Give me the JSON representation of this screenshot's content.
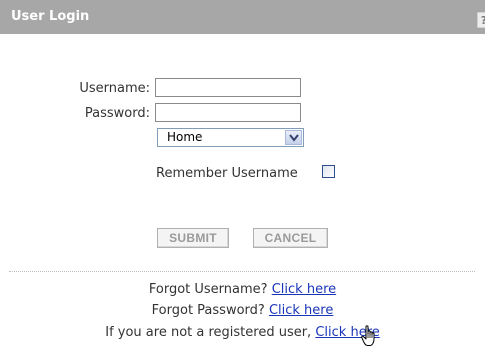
{
  "header": {
    "title": "User Login",
    "help_label": "?"
  },
  "form": {
    "username_label": "Username:",
    "username_value": "",
    "password_label": "Password:",
    "password_value": "",
    "location_select": {
      "selected": "Home"
    },
    "remember_label": "Remember Username",
    "remember_checked": false,
    "submit_label": "SUBMIT",
    "cancel_label": "CANCEL"
  },
  "footer": {
    "forgot_username_text": "Forgot Username?",
    "forgot_username_link": "Click here",
    "forgot_password_text": "Forgot Password?",
    "forgot_password_link": "Click here",
    "register_text": "If you are not a registered user,",
    "register_link": "Click here"
  },
  "colors": {
    "header_bg": "#a7a7a7",
    "link": "#1a35b8",
    "button_text": "#9a9a9a"
  },
  "icons": {
    "select_arrow": "chevron-down-icon",
    "cursor": "hand-pointer-icon"
  }
}
